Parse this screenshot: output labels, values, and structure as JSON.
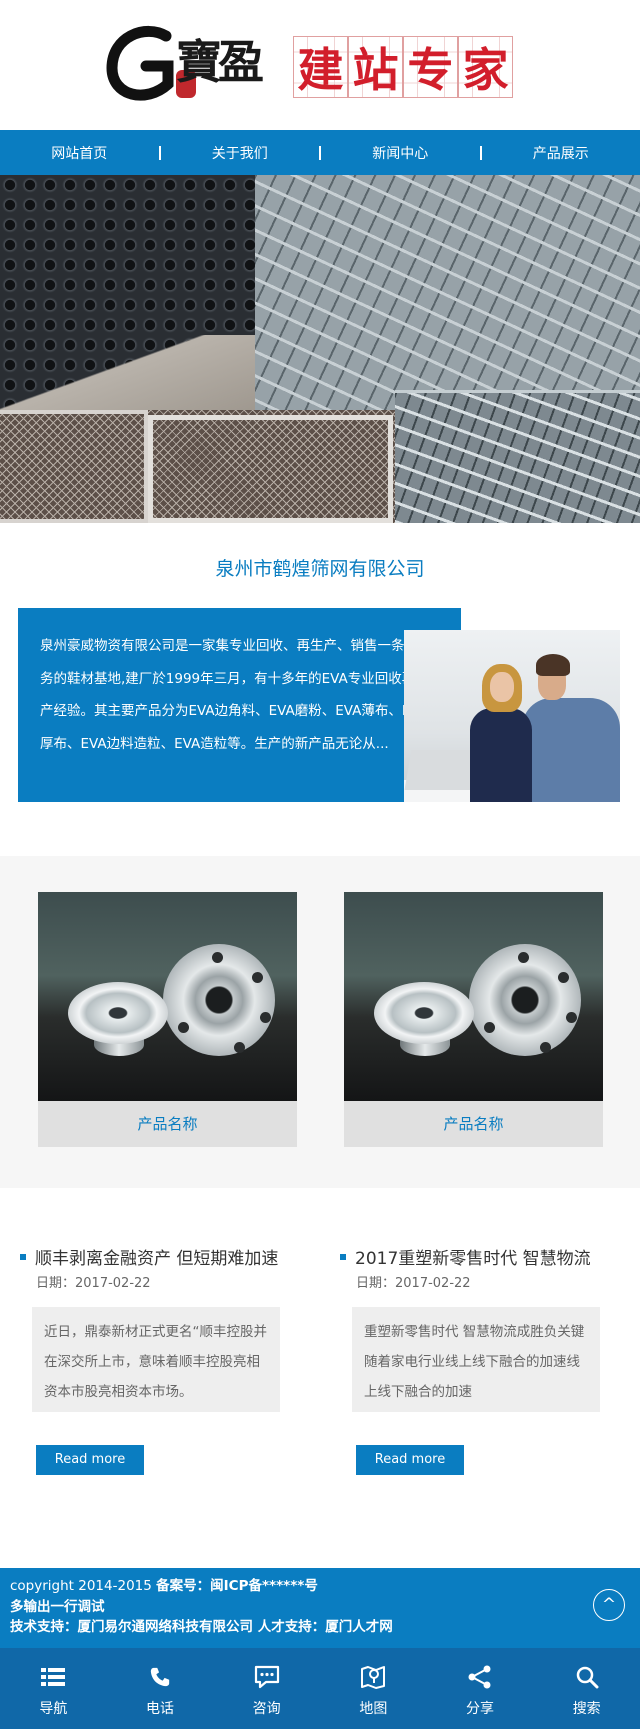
{
  "header": {
    "logo_text": "寶盈",
    "slogan": [
      "建",
      "站",
      "专",
      "家"
    ]
  },
  "nav": {
    "items": [
      {
        "label": "网站首页"
      },
      {
        "label": "关于我们"
      },
      {
        "label": "新闻中心"
      },
      {
        "label": "产品展示"
      }
    ]
  },
  "company": {
    "title": "泉州市鹤煌筛网有限公司",
    "description": "泉州豪威物资有限公司是一家集专业回收、再生产、销售一条龙服务的鞋材基地,建厂於1999年三月，有十多年的EVA专业回收再生产经验。其主要产品分为EVA边角料、EVA磨粉、EVA薄布、EVA厚布、EVA边料造粒、EVA造粒等。生产的新产品无论从..."
  },
  "products": [
    {
      "name": "产品名称"
    },
    {
      "name": "产品名称"
    }
  ],
  "news": [
    {
      "title": "顺丰剥离金融资产 但短期难加速",
      "date": "日期：2017-02-22",
      "summary": "近日，鼎泰新材正式更名“顺丰控股并在深交所上市，意味着顺丰控股亮相资本市股亮相资本市场。",
      "read_more": "Read more"
    },
    {
      "title": "2017重塑新零售时代 智慧物流",
      "date": "日期：2017-02-22",
      "summary": "重塑新零售时代 智慧物流成胜负关键随着家电行业线上线下融合的加速线上线下融合的加速",
      "read_more": "Read more"
    }
  ],
  "footer": {
    "line1": "copyright 2014-2015",
    "record_label": "备案号：闽ICP备******号",
    "line2": "多输出一行调试",
    "line3": "技术支持：厦门易尔通网络科技有限公司 人才支持：厦门人才网",
    "back_top": "^"
  },
  "bottom_bar": {
    "items": [
      {
        "label": "导航",
        "icon": "menu-icon"
      },
      {
        "label": "电话",
        "icon": "phone-icon"
      },
      {
        "label": "咨询",
        "icon": "chat-icon"
      },
      {
        "label": "地图",
        "icon": "map-icon"
      },
      {
        "label": "分享",
        "icon": "share-icon"
      },
      {
        "label": "搜索",
        "icon": "search-icon"
      }
    ]
  },
  "colors": {
    "primary": "#0a7dc1",
    "bottom_bar": "#1068a8",
    "slogan_red": "#d21e2b"
  }
}
